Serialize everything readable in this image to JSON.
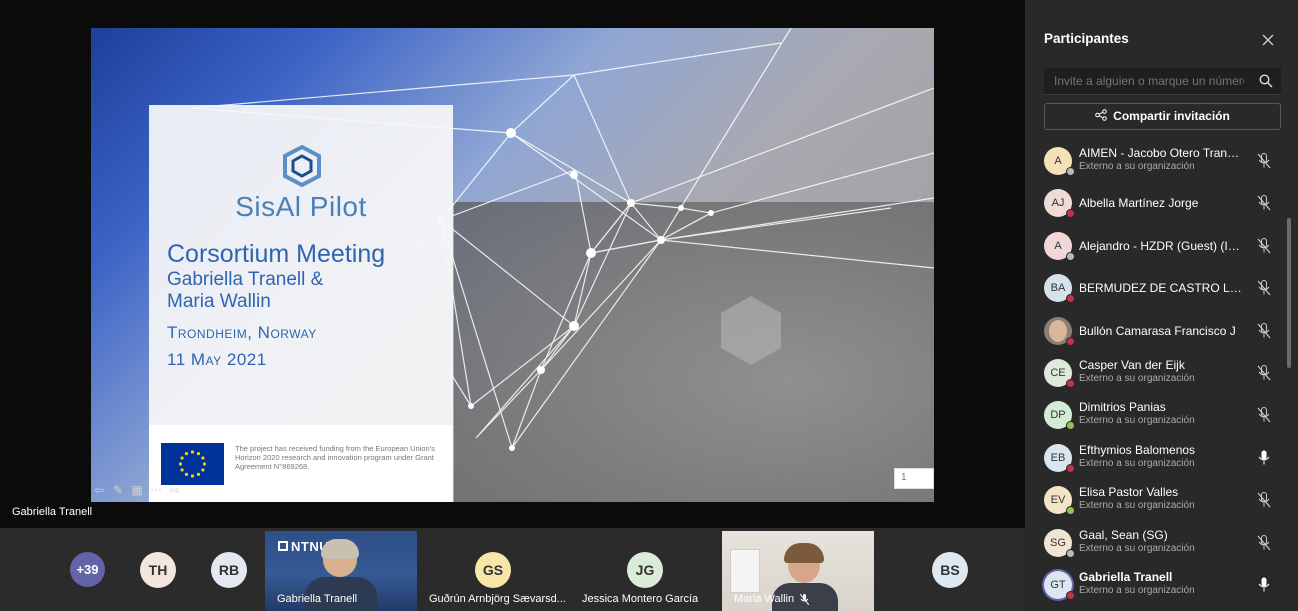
{
  "meeting": {
    "presenter_label": "Gabriella Tranell"
  },
  "slide": {
    "brand": "SisAl Pilot",
    "title": "Corsortium Meeting",
    "authors_line1": "Gabriella Tranell &",
    "authors_line2": "Maria Wallin",
    "location": "Trondheim, Norway",
    "date": "11 May 2021",
    "funding_text": "The project has received funding from the European Union's Horizon 2020 research and innovation program under Grant Agreement N°869268.",
    "page_number": "1"
  },
  "strip": {
    "overflow_count": "+39",
    "avatars": [
      {
        "initials": "TH",
        "color": "#f2e6df"
      },
      {
        "initials": "RB",
        "color": "#e4e8f1"
      },
      {
        "initials": "GS",
        "color": "#f6e6a8"
      },
      {
        "initials": "JG",
        "color": "#d9ecd9"
      },
      {
        "initials": "BS",
        "color": "#dde8f0"
      }
    ],
    "tiles": [
      {
        "name": "Gabriella Tranell",
        "org_text": "NTNU"
      },
      {
        "name": "Guðrún Arnbjörg Sævarsd..."
      },
      {
        "name": "Jessica Montero García"
      },
      {
        "name": "Maria Wallin"
      }
    ]
  },
  "panel": {
    "title": "Participantes",
    "search_placeholder": "Invite a alguien o marque un número",
    "invite_button": "Compartir invitación",
    "participants": [
      {
        "initials": "A",
        "name": "AIMEN - Jacobo Otero Tranch...",
        "sub": "Externo a su organización",
        "avatar_color": "#f3e2b8",
        "status_color": "#b9b9b9",
        "muted": true
      },
      {
        "initials": "AJ",
        "name": "Albella Martínez Jorge",
        "sub": "",
        "avatar_color": "#f0dcd6",
        "status_color": "#c4314b",
        "muted": true
      },
      {
        "initials": "A",
        "name": "Alejandro - HZDR (Guest) (Inv...",
        "sub": "",
        "avatar_color": "#f1d7d7",
        "status_color": "#b9b9b9",
        "muted": true
      },
      {
        "initials": "BA",
        "name": "BERMUDEZ DE CASTRO LOPE...",
        "sub": "",
        "avatar_color": "#d5e2ea",
        "status_color": "#c4314b",
        "muted": true
      },
      {
        "initials": "",
        "name": "Bullón Camarasa Francisco J",
        "sub": "",
        "avatar_color": "#8a7f74",
        "status_color": "#c4314b",
        "muted": true,
        "photo": true
      },
      {
        "initials": "CE",
        "name": "Casper Van der Eijk",
        "sub": "Externo a su organización",
        "avatar_color": "#dfe8dc",
        "status_color": "#c4314b",
        "muted": true
      },
      {
        "initials": "DP",
        "name": "Dimitrios Panias",
        "sub": "Externo a su organización",
        "avatar_color": "#d4ecd5",
        "status_color": "#92c353",
        "muted": true
      },
      {
        "initials": "EB",
        "name": "Efthymios Balomenos",
        "sub": "Externo a su organización",
        "avatar_color": "#dae6ef",
        "status_color": "#c4314b",
        "muted": false
      },
      {
        "initials": "EV",
        "name": "Elisa Pastor Valles",
        "sub": "Externo a su organización",
        "avatar_color": "#f3e4c7",
        "status_color": "#92c353",
        "muted": true
      },
      {
        "initials": "SG",
        "name": "Gaal, Sean (SG)",
        "sub": "Externo a su organización",
        "avatar_color": "#f1e4d4",
        "status_color": "#b9b9b9",
        "muted": true
      },
      {
        "initials": "GT",
        "name": "Gabriella Tranell",
        "sub": "Externo a su organización",
        "avatar_color": "#dbe6f1",
        "status_color": "#c4314b",
        "muted": false,
        "bold": true
      }
    ]
  }
}
